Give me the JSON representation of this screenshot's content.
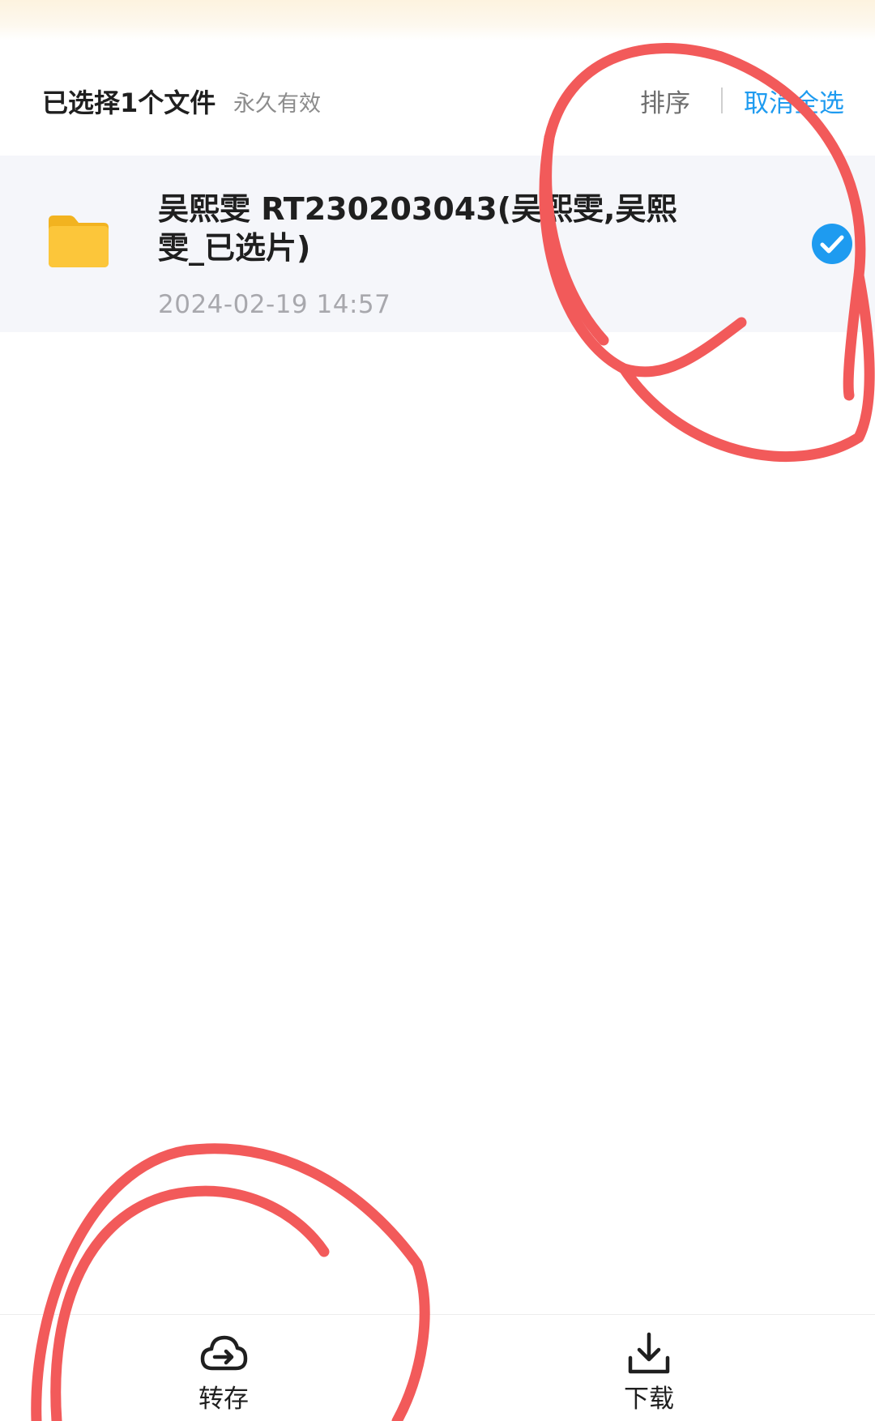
{
  "header": {
    "title": "已选择1个文件",
    "validity": "永久有效",
    "sort_label": "排序",
    "deselect_label": "取消全选"
  },
  "file": {
    "name": "吴熙雯 RT230203043(吴熙雯,吴熙雯_已选片)",
    "date": "2024-02-19 14:57",
    "icon": "folder-icon",
    "selected": true
  },
  "bottom_bar": {
    "save_label": "转存",
    "save_icon": "cloud-transfer-icon",
    "download_label": "下载",
    "download_icon": "download-icon"
  },
  "colors": {
    "accent": "#1e9bf0",
    "folder": "#fcc63a",
    "annotation": "#f25a5a"
  }
}
